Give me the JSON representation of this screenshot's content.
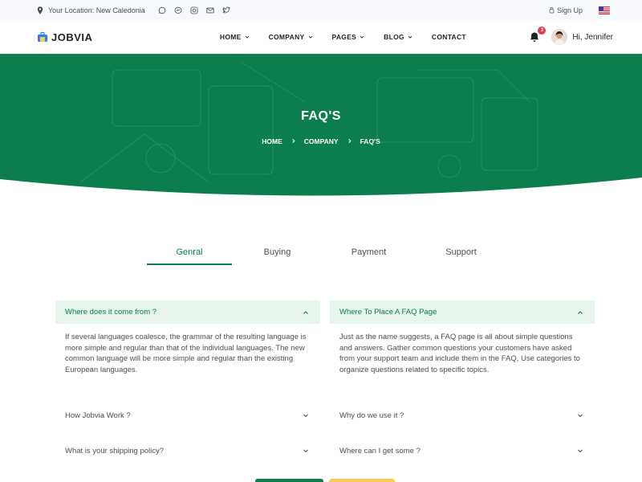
{
  "topbar": {
    "location_label": "Your Location: New Caledonia",
    "social_icons": [
      "whatsapp-icon",
      "messenger-icon",
      "instagram-icon",
      "mail-icon",
      "twitter-icon"
    ],
    "signup_label": "Sign Up"
  },
  "navbar": {
    "brand": "JOBVIA",
    "menu": [
      {
        "label": "HOME",
        "dropdown": true
      },
      {
        "label": "COMPANY",
        "dropdown": true
      },
      {
        "label": "PAGES",
        "dropdown": true
      },
      {
        "label": "BLOG",
        "dropdown": true
      },
      {
        "label": "CONTACT",
        "dropdown": false
      }
    ],
    "notification_count": "3",
    "greeting": "Hi, Jennifer"
  },
  "hero": {
    "title": "FAQ'S",
    "breadcrumb": [
      "HOME",
      "COMPANY",
      "FAQ'S"
    ]
  },
  "tabs": [
    "Genral",
    "Buying",
    "Payment",
    "Support"
  ],
  "faq": {
    "left": {
      "open_question": "Where does it come from ?",
      "open_answer": "If several languages coalesce, the grammar of the resulting language is more simple and regular than that of the individual languages. The new common language will be more simple and regular than the existing European languages.",
      "closed": [
        "How Jobvia Work ?",
        "What is your shipping policy?"
      ]
    },
    "right": {
      "open_question": "Where To Place A FAQ Page",
      "open_answer": "Just as the name suggests, a FAQ page is all about simple questions and answers. Gather common questions your customers have asked from your support team and include them in the FAQ, Use categories to organize questions related to specific topics.",
      "closed": [
        "Why do we use it ?",
        "Where can I get some ?"
      ]
    }
  },
  "colors": {
    "primary": "#0c7e4e",
    "accent_light": "#e6f4ec",
    "warning": "#f7cc53",
    "badge": "#e63757"
  }
}
